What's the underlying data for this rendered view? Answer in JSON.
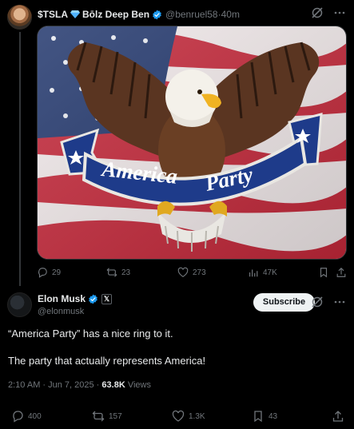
{
  "quoted_post": {
    "display_name": "$TSLA",
    "display_name_2": "Bōlz Deep Ben",
    "handle": "@benruel58",
    "separator": " · ",
    "time": "40m",
    "actions": {
      "replies": "29",
      "reposts": "23",
      "likes": "273",
      "views": "47K"
    },
    "media_banner_text": "America Party"
  },
  "main_post": {
    "display_name": "Elon Musk",
    "handle": "@elonmusk",
    "subscribe_label": "Subscribe",
    "badge_label": "𝕏",
    "text_line_1": "“America Party” has a nice ring to it.",
    "text_line_2": "The party that actually represents America!",
    "timestamp": "2:10 AM · Jun 7, 2025 · ",
    "views_count": "63.8K",
    "views_label": " Views",
    "actions": {
      "replies": "400",
      "reposts": "157",
      "likes": "1.3K",
      "bookmarks": "43"
    }
  },
  "colors": {
    "background": "#000000",
    "text_primary": "#e7e9ea",
    "text_secondary": "#71767b",
    "verified_blue": "#1d9bf0",
    "divider": "#2f3336"
  }
}
